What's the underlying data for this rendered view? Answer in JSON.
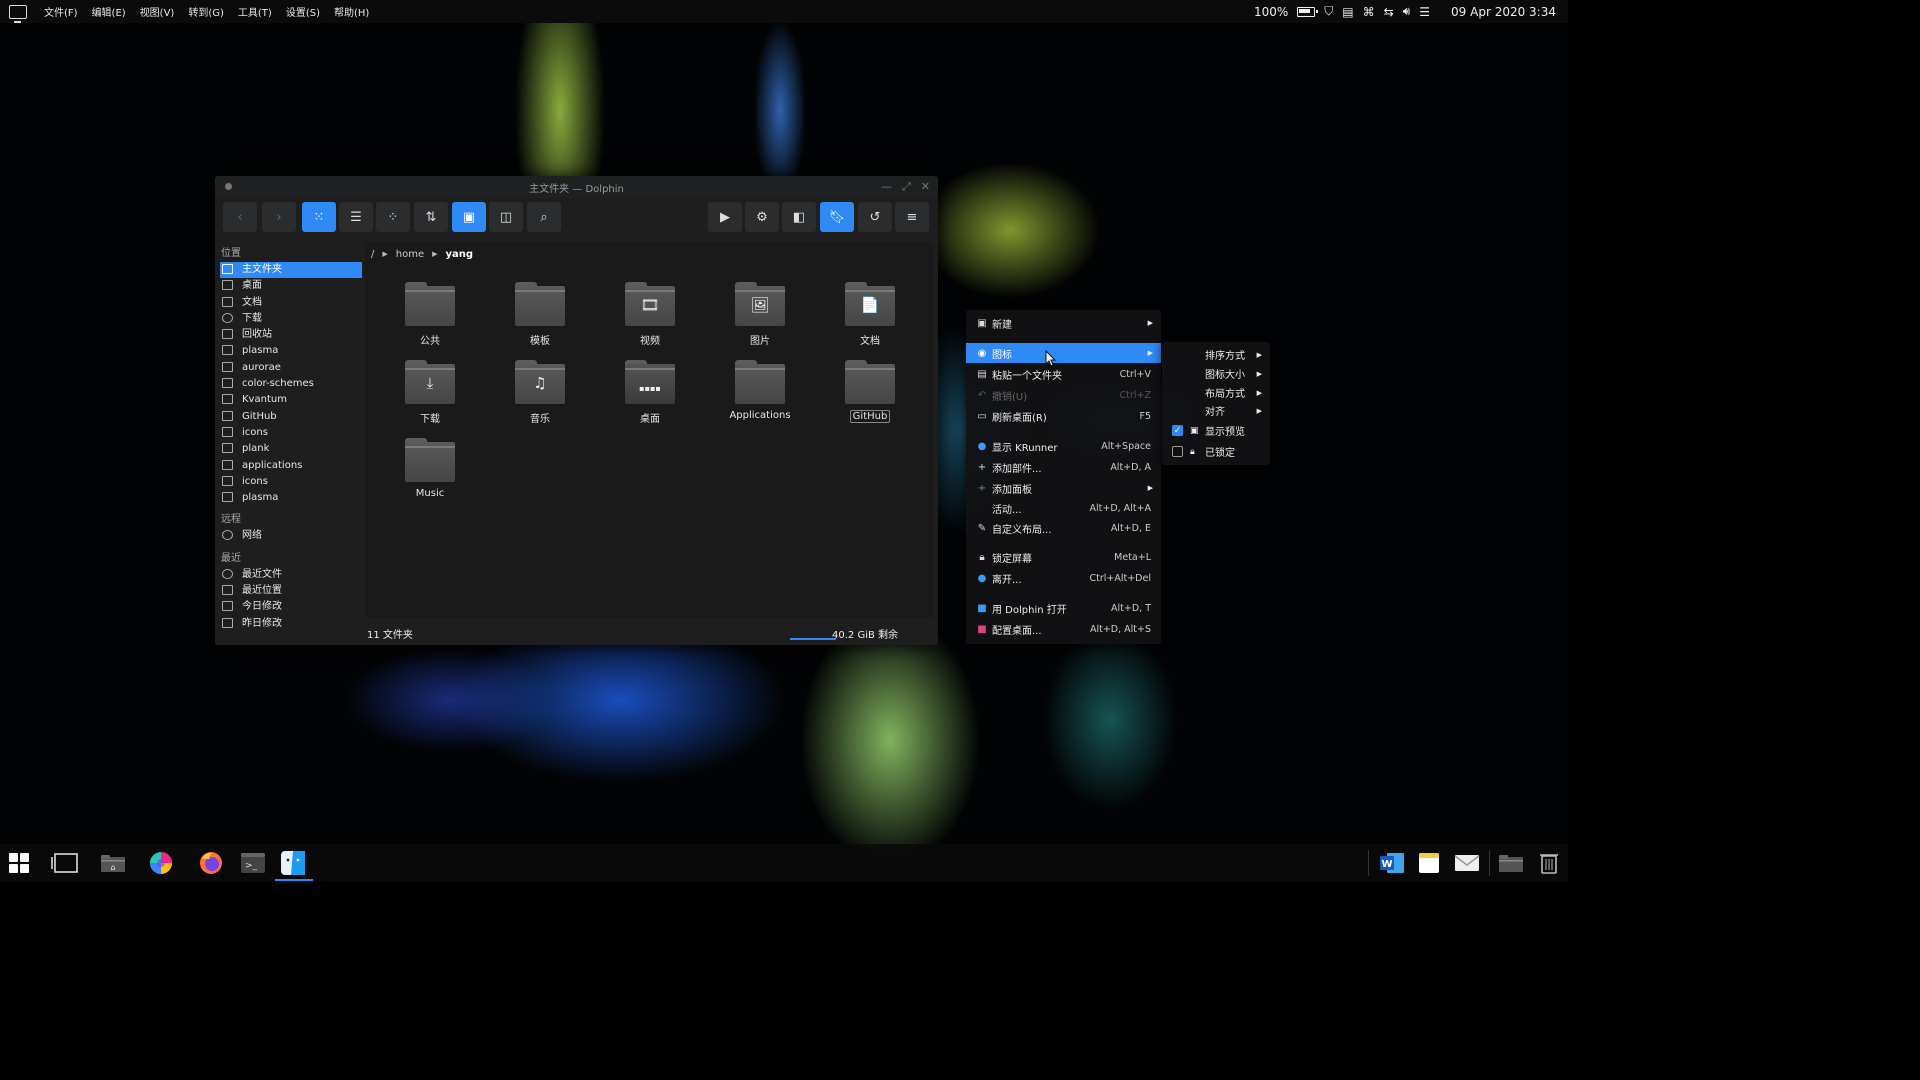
{
  "top_menu": [
    "文件(F)",
    "编辑(E)",
    "视图(V)",
    "转到(G)",
    "工具(T)",
    "设置(S)",
    "帮助(H)"
  ],
  "tray": {
    "battery_percent": "100%",
    "datetime": "09 Apr 2020 3:34"
  },
  "window": {
    "title": "主文件夹 — Dolphin",
    "breadcrumb": [
      "/",
      "home",
      "yang"
    ],
    "sidebar": {
      "places_heading": "位置",
      "places": [
        "主文件夹",
        "桌面",
        "文档",
        "下载",
        "回收站",
        "plasma",
        "aurorae",
        "color-schemes",
        "Kvantum",
        "GitHub",
        "icons",
        "plank",
        "applications",
        "icons",
        "plasma"
      ],
      "remote_heading": "远程",
      "remote": [
        "网络"
      ],
      "recent_heading": "最近",
      "recent": [
        "最近文件",
        "最近位置",
        "今日修改",
        "昨日修改"
      ]
    },
    "files": [
      {
        "name": "公共",
        "emblem": ""
      },
      {
        "name": "模板",
        "emblem": ""
      },
      {
        "name": "视频",
        "emblem": "🎞"
      },
      {
        "name": "图片",
        "emblem": "🖼"
      },
      {
        "name": "文档",
        "emblem": "📄"
      },
      {
        "name": "下载",
        "emblem": "⤓"
      },
      {
        "name": "音乐",
        "emblem": "♫"
      },
      {
        "name": "桌面",
        "emblem": "▪▪▪▪"
      },
      {
        "name": "Applications",
        "emblem": ""
      },
      {
        "name": "GitHub",
        "emblem": ""
      },
      {
        "name": "Music",
        "emblem": ""
      }
    ],
    "status": {
      "count": "11 文件夹",
      "free": "40.2 GiB 剩余"
    }
  },
  "context_menu": [
    {
      "label": "新建",
      "shortcut": "",
      "icon": "new-icon"
    },
    {
      "label": "图标",
      "shortcut": "",
      "icon": "icons-icon"
    },
    {
      "label": "粘贴一个文件夹",
      "shortcut": "Ctrl+V",
      "icon": "paste-icon"
    },
    {
      "label": "撤销(U)",
      "shortcut": "Ctrl+Z",
      "icon": "undo-icon"
    },
    {
      "label": "刷新桌面(R)",
      "shortcut": "F5",
      "icon": "refresh-icon"
    },
    {
      "label": "显示 KRunner",
      "shortcut": "Alt+Space",
      "icon": "krunner-icon"
    },
    {
      "label": "添加部件...",
      "shortcut": "Alt+D, A",
      "icon": "add-icon"
    },
    {
      "label": "添加面板",
      "shortcut": "",
      "icon": "add-panel-icon"
    },
    {
      "label": "活动...",
      "shortcut": "Alt+D, Alt+A",
      "icon": ""
    },
    {
      "label": "自定义布局...",
      "shortcut": "Alt+D, E",
      "icon": "pencil-icon"
    },
    {
      "label": "锁定屏幕",
      "shortcut": "Meta+L",
      "icon": "lock-icon"
    },
    {
      "label": "离开...",
      "shortcut": "Ctrl+Alt+Del",
      "icon": "leave-icon"
    },
    {
      "label": "用 Dolphin 打开",
      "shortcut": "Alt+D, T",
      "icon": "dolphin-icon"
    },
    {
      "label": "配置桌面...",
      "shortcut": "Alt+D, Alt+S",
      "icon": "configure-icon"
    }
  ],
  "icons_submenu": [
    {
      "label": "排序方式"
    },
    {
      "label": "图标大小"
    },
    {
      "label": "布局方式"
    },
    {
      "label": "对齐"
    },
    {
      "label": "显示预览",
      "checked": true
    },
    {
      "label": "已锁定",
      "checked": false
    }
  ],
  "colors": {
    "accent": "#2f8af5",
    "window_bg": "#1e1e1e",
    "content_bg": "#1a1a1a"
  }
}
